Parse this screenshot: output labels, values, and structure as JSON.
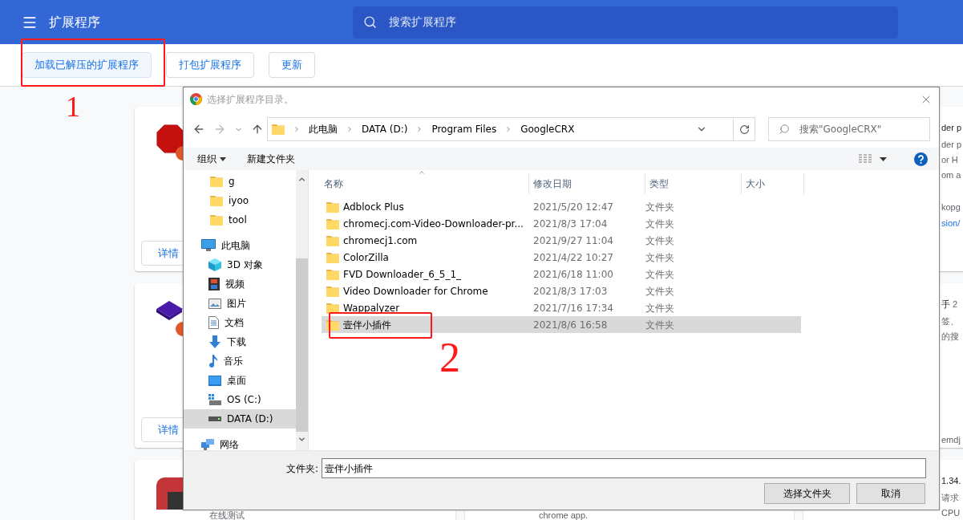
{
  "page": {
    "title": "扩展程序",
    "search_placeholder": "搜索扩展程序"
  },
  "toolbar_buttons": [
    {
      "label": "加载已解压的扩展程序",
      "highlighted": true
    },
    {
      "label": "打包扩展程序",
      "highlighted": false
    },
    {
      "label": "更新",
      "highlighted": false
    }
  ],
  "left_column_cards": [
    {
      "kind": "abp",
      "button": "详情"
    },
    {
      "kind": "wappalyzer",
      "button": "详情"
    },
    {
      "kind": "red_app",
      "lines": [
        "在线测试"
      ]
    }
  ],
  "middle_column_cards": [
    {
      "lines": [
        "chrome app."
      ]
    }
  ],
  "right_column_cards": [
    {
      "lines": [
        {
          "text": "der p",
          "kind": "title"
        },
        {
          "text": "der p",
          "kind": "text"
        },
        {
          "text": "or H",
          "kind": "text"
        },
        {
          "text": "om a",
          "kind": "text"
        },
        {
          "text": "kopg",
          "kind": "id"
        },
        {
          "text": "sion/",
          "kind": "link"
        }
      ]
    },
    {
      "lines": [
        {
          "text": "手",
          "kind": "title",
          "version": "2"
        },
        {
          "text": "签、",
          "kind": "text"
        },
        {
          "text": "的搜",
          "kind": "text"
        },
        {
          "text": "emdj",
          "kind": "id"
        }
      ]
    },
    {
      "lines": [
        {
          "text": "1.34.",
          "kind": "title"
        },
        {
          "text": "请求",
          "kind": "text"
        },
        {
          "text": "CPU",
          "kind": "text"
        }
      ]
    }
  ],
  "dialog": {
    "title": "选择扩展程序目录。",
    "breadcrumbs": [
      "此电脑",
      "DATA (D:)",
      "Program Files",
      "GoogleCRX"
    ],
    "search_placeholder": "搜索\"GoogleCRX\"",
    "toolbar": {
      "organize": "组织",
      "new_folder": "新建文件夹"
    },
    "nav": [
      {
        "label": "g",
        "kind": "folder",
        "selected": false
      },
      {
        "label": "iyoo",
        "kind": "folder",
        "selected": false
      },
      {
        "label": "tool",
        "kind": "folder",
        "selected": false
      },
      {
        "label": "此电脑",
        "kind": "pc",
        "selected": false,
        "children": [
          {
            "label": "3D 对象",
            "kind": "cube",
            "selected": false
          },
          {
            "label": "视频",
            "kind": "film",
            "selected": false
          },
          {
            "label": "图片",
            "kind": "picture",
            "selected": false
          },
          {
            "label": "文档",
            "kind": "document",
            "selected": false
          },
          {
            "label": "下载",
            "kind": "download",
            "selected": false
          },
          {
            "label": "音乐",
            "kind": "music",
            "selected": false
          },
          {
            "label": "桌面",
            "kind": "desktop",
            "selected": false
          },
          {
            "label": "OS (C:)",
            "kind": "system_drive",
            "selected": false
          },
          {
            "label": "DATA (D:)",
            "kind": "drive",
            "selected": true
          }
        ]
      },
      {
        "label": "网络",
        "kind": "network",
        "selected": false
      }
    ],
    "columns": [
      "名称",
      "修改日期",
      "类型",
      "大小"
    ],
    "files": [
      {
        "name": "Adblock Plus",
        "date": "2021/5/20 12:47",
        "type": "文件夹",
        "selected": false
      },
      {
        "name": "chromecj.com-Video-Downloader-pr...",
        "date": "2021/8/3 17:04",
        "type": "文件夹",
        "selected": false
      },
      {
        "name": "chromecj1.com",
        "date": "2021/9/27 11:04",
        "type": "文件夹",
        "selected": false
      },
      {
        "name": "ColorZilla",
        "date": "2021/4/22 10:27",
        "type": "文件夹",
        "selected": false
      },
      {
        "name": "FVD Downloader_6_5_1_",
        "date": "2021/6/18 11:00",
        "type": "文件夹",
        "selected": false
      },
      {
        "name": "Video Downloader for Chrome",
        "date": "2021/8/3 17:03",
        "type": "文件夹",
        "selected": false
      },
      {
        "name": "Wappalyzer",
        "date": "2021/7/16 17:34",
        "type": "文件夹",
        "selected": false
      },
      {
        "name": "壹伴小插件",
        "date": "2021/8/6 16:58",
        "type": "文件夹",
        "selected": true
      }
    ],
    "folder_label": "文件夹:",
    "folder_value": "壹伴小插件",
    "buttons": [
      "选择文件夹",
      "取消"
    ]
  },
  "annotations": [
    "1",
    "2"
  ]
}
